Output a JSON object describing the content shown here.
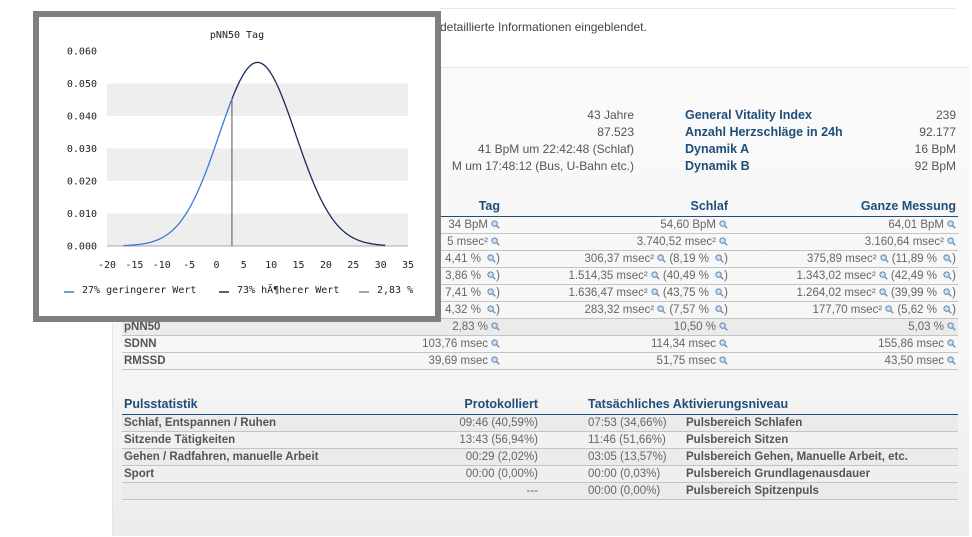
{
  "intro_text": "detaillierte Informationen eingeblendet.",
  "profile": {
    "stats": [
      {
        "value": "43 Jahre"
      },
      {
        "value": "87.523"
      },
      {
        "value": "41 BpM um 22:42:48 (Schlaf)"
      },
      {
        "value": "M um 17:48:12 (Bus, U-Bahn etc.)"
      }
    ],
    "vitality": [
      {
        "label": "General Vitality Index",
        "value": "239"
      },
      {
        "label": "Anzahl Herzschläge in 24h",
        "value": "92.177"
      },
      {
        "label": "Dynamik A",
        "value": "16 BpM"
      },
      {
        "label": "Dynamik B",
        "value": "92 BpM"
      }
    ]
  },
  "hrv_table": {
    "headers": [
      "",
      "Tag",
      "Schlaf",
      "Ganze Messung"
    ],
    "rows": [
      {
        "label": "",
        "tag": "34 BpM",
        "schlaf": "54,60 BpM",
        "ganz": "64,01 BpM"
      },
      {
        "label": "",
        "tag": "5 msec²",
        "schlaf": "3.740,52 msec²",
        "ganz": "3.160,64 msec²"
      },
      {
        "label": "",
        "tag": "4,41 % ",
        "tag_close": ")",
        "schlaf": "306,37 msec²",
        "schlaf_pct": " (8,19 % ",
        "schlaf_close": ")",
        "ganz": "375,89 msec²",
        "ganz_pct": " (11,89 % ",
        "ganz_close": ")"
      },
      {
        "label": "",
        "tag": "3,86 % ",
        "tag_close": ")",
        "schlaf": "1.514,35 msec²",
        "schlaf_pct": " (40,49 % ",
        "schlaf_close": ")",
        "ganz": "1.343,02 msec²",
        "ganz_pct": " (42,49 % ",
        "ganz_close": ")"
      },
      {
        "label": "",
        "tag": "7,41 % ",
        "tag_close": ")",
        "schlaf": "1.636,47 msec²",
        "schlaf_pct": " (43,75 % ",
        "schlaf_close": ")",
        "ganz": "1.264,02 msec²",
        "ganz_pct": " (39,99 % ",
        "ganz_close": ")"
      },
      {
        "label": "",
        "tag": "4,32 % ",
        "tag_close": ")",
        "schlaf": "283,32 msec²",
        "schlaf_pct": " (7,57 % ",
        "schlaf_close": ")",
        "ganz": "177,70 msec²",
        "ganz_pct": " (5,62 % ",
        "ganz_close": ")"
      },
      {
        "label": "pNN50",
        "tag": "2,83 %",
        "schlaf": "10,50 %",
        "ganz": "5,03 %"
      },
      {
        "label": "SDNN",
        "tag": "103,76 msec",
        "schlaf": "114,34 msec",
        "ganz": "155,86 msec"
      },
      {
        "label": "RMSSD",
        "tag": "39,69 msec",
        "schlaf": "51,75 msec",
        "ganz": "43,50 msec"
      }
    ]
  },
  "pulse_table": {
    "headers": [
      "Pulsstatistik",
      "Protokolliert",
      "Tatsächliches Aktivierungsniveau"
    ],
    "rows": [
      {
        "label": "Schlaf, Entspannen / Ruhen",
        "prot": "09:46 (40,59%)",
        "act": "07:53 (34,66%)",
        "level": "Pulsbereich Schlafen"
      },
      {
        "label": "Sitzende Tätigkeiten",
        "prot": "13:43 (56,94%)",
        "act": "11:46 (51,66%)",
        "level": "Pulsbereich Sitzen"
      },
      {
        "label": "Gehen / Radfahren, manuelle Arbeit",
        "prot": "00:29 (2,02%)",
        "act": "03:05 (13,57%)",
        "level": "Pulsbereich Gehen, Manuelle Arbeit, etc."
      },
      {
        "label": "Sport",
        "prot": "00:00 (0,00%)",
        "act": "00:00 (0,03%)",
        "level": "Pulsbereich Grundlagenausdauer"
      },
      {
        "label": "",
        "prot": "---",
        "act": "00:00 (0,00%)",
        "level": "Pulsbereich Spitzenpuls"
      }
    ]
  },
  "chart_data": {
    "type": "area",
    "title": "pNN50 Tag",
    "x_ticks": [
      -20,
      -15,
      -10,
      -5,
      0,
      5,
      10,
      15,
      20,
      25,
      30,
      35
    ],
    "y_ticks": [
      "0.000",
      "0.010",
      "0.020",
      "0.030",
      "0.040",
      "0.050",
      "0.060"
    ],
    "xlim": [
      -20,
      35
    ],
    "ylim": [
      0,
      0.06
    ],
    "grid": "alternating horizontal bands",
    "distribution": {
      "mean": 7.5,
      "sd": 7.0,
      "peak": 0.0565,
      "x_range": [
        -17,
        31
      ]
    },
    "marker_x": 2.83,
    "series": [
      {
        "name": "27% geringerer Wert",
        "color": "#3a7ad8",
        "range": "below marker"
      },
      {
        "name": "73% hÃ¶herer Wert",
        "color": "#1a2a5e",
        "range": "above marker"
      },
      {
        "name": "2,83 %",
        "color": "#888888",
        "range": "marker"
      }
    ],
    "legend_position": "bottom"
  }
}
